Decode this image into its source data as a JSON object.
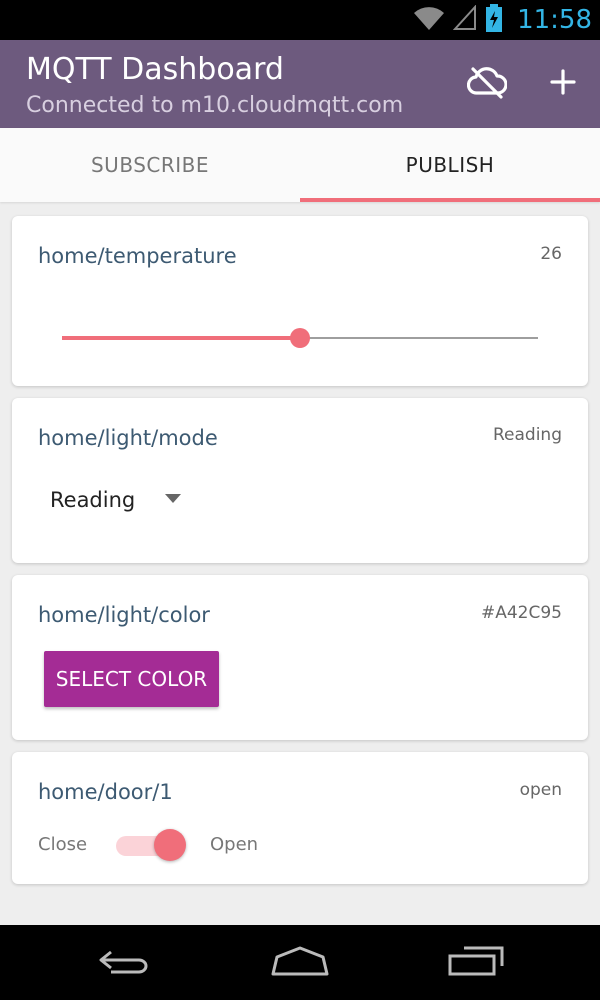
{
  "status_bar": {
    "time": "11:58",
    "icons": [
      "wifi-icon",
      "signal-icon",
      "battery-charging-icon"
    ],
    "clock_color": "#33b5e5"
  },
  "app_bar": {
    "title": "MQTT Dashboard",
    "subtitle": "Connected to m10.cloudmqtt.com",
    "background": "#6d5a7e",
    "actions": [
      "cloud-off-icon",
      "add-icon"
    ]
  },
  "tabs": {
    "items": [
      {
        "label": "SUBSCRIBE",
        "selected": false
      },
      {
        "label": "PUBLISH",
        "selected": true
      }
    ],
    "indicator_color": "#f06e7a"
  },
  "cards": {
    "temperature": {
      "topic": "home/temperature",
      "value": "26",
      "slider_fraction": 0.5
    },
    "light_mode": {
      "topic": "home/light/mode",
      "value": "Reading",
      "selected_option": "Reading"
    },
    "light_color": {
      "topic": "home/light/color",
      "value": "#A42C95",
      "button_label": "SELECT COLOR",
      "button_color": "#a42c95"
    },
    "door": {
      "topic": "home/door/1",
      "value": "open",
      "off_label": "Close",
      "on_label": "Open",
      "switch_on": true
    }
  },
  "nav_bar": {
    "buttons": [
      "back-icon",
      "home-icon",
      "recents-icon"
    ]
  },
  "accent_color": "#f06e7a"
}
